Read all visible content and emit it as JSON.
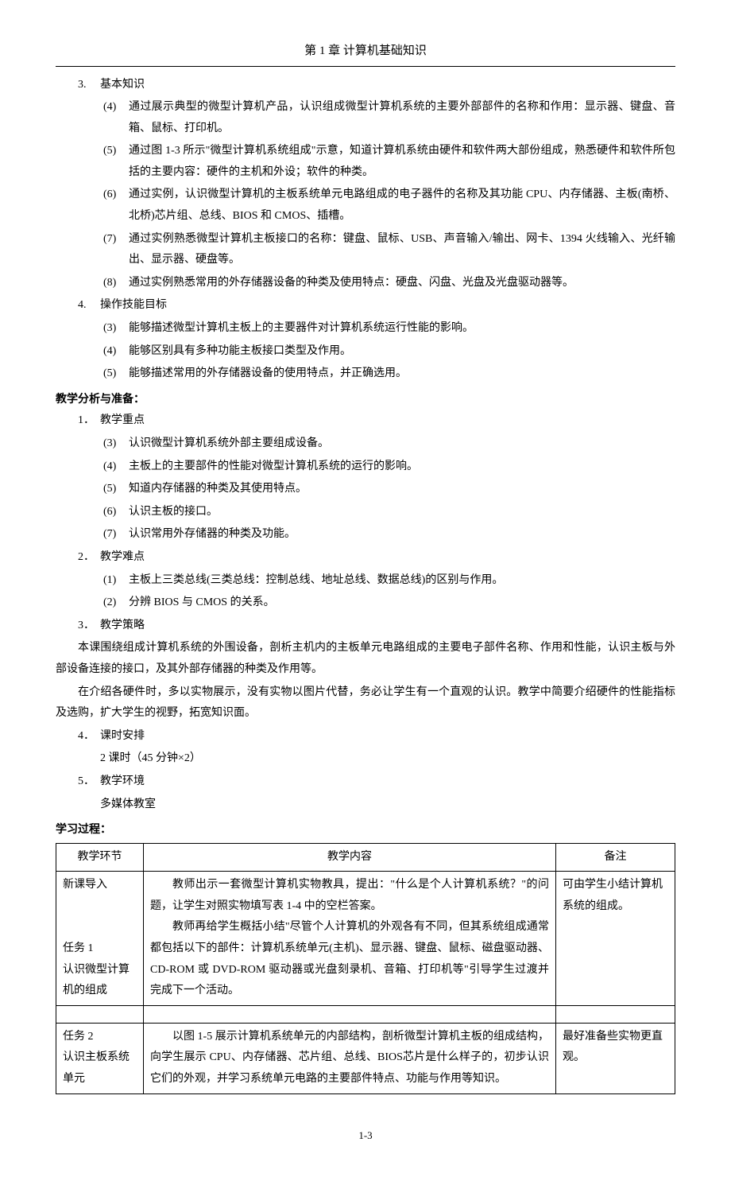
{
  "chapter_title": "第 1 章  计算机基础知识",
  "sections": {
    "s3": {
      "num": "3.",
      "title": "基本知识"
    },
    "s3_items": {
      "i4": {
        "num": "(4)",
        "text": "通过展示典型的微型计算机产品，认识组成微型计算机系统的主要外部部件的名称和作用：显示器、键盘、音箱、鼠标、打印机。"
      },
      "i5": {
        "num": "(5)",
        "text": "通过图 1-3 所示\"微型计算机系统组成\"示意，知道计算机系统由硬件和软件两大部份组成，熟悉硬件和软件所包括的主要内容：硬件的主机和外设；软件的种类。"
      },
      "i6": {
        "num": "(6)",
        "text": "通过实例，认识微型计算机的主板系统单元电路组成的电子器件的名称及其功能 CPU、内存储器、主板(南桥、北桥)芯片组、总线、BIOS 和 CMOS、插槽。"
      },
      "i7": {
        "num": "(7)",
        "text": "通过实例熟悉微型计算机主板接口的名称：键盘、鼠标、USB、声音输入/输出、网卡、1394 火线输入、光纤输出、显示器、硬盘等。"
      },
      "i8": {
        "num": "(8)",
        "text": "通过实例熟悉常用的外存储器设备的种类及使用特点：硬盘、闪盘、光盘及光盘驱动器等。"
      }
    },
    "s4": {
      "num": "4.",
      "title": "操作技能目标"
    },
    "s4_items": {
      "i3": {
        "num": "(3)",
        "text": "能够描述微型计算机主板上的主要器件对计算机系统运行性能的影响。"
      },
      "i4": {
        "num": "(4)",
        "text": "能够区别具有多种功能主板接口类型及作用。"
      },
      "i5": {
        "num": "(5)",
        "text": "能够描述常用的外存储器设备的使用特点，并正确选用。"
      }
    }
  },
  "analysis_heading": "教学分析与准备：",
  "analysis": {
    "a1": {
      "num": "1．",
      "title": "教学重点"
    },
    "a1_items": {
      "i3": {
        "num": "(3)",
        "text": "认识微型计算机系统外部主要组成设备。"
      },
      "i4": {
        "num": "(4)",
        "text": "主板上的主要部件的性能对微型计算机系统的运行的影响。"
      },
      "i5": {
        "num": "(5)",
        "text": "知道内存储器的种类及其使用特点。"
      },
      "i6": {
        "num": "(6)",
        "text": "认识主板的接口。"
      },
      "i7": {
        "num": "(7)",
        "text": "认识常用外存储器的种类及功能。"
      }
    },
    "a2": {
      "num": "2．",
      "title": "教学难点"
    },
    "a2_items": {
      "i1": {
        "num": "(1)",
        "text": "主板上三类总线(三类总线：控制总线、地址总线、数据总线)的区别与作用。"
      },
      "i2": {
        "num": "(2)",
        "text": "分辨 BIOS 与 CMOS 的关系。"
      }
    },
    "a3": {
      "num": "3．",
      "title": "教学策略"
    },
    "a3_para1": "本课围绕组成计算机系统的外围设备，剖析主机内的主板单元电路组成的主要电子部件名称、作用和性能，认识主板与外部设备连接的接口，及其外部存储器的种类及作用等。",
    "a3_para2": "在介绍各硬件时，多以实物展示，没有实物以图片代替，务必让学生有一个直观的认识。教学中简要介绍硬件的性能指标及选购，扩大学生的视野，拓宽知识面。",
    "a4": {
      "num": "4．",
      "title": "课时安排"
    },
    "a4_text": "2 课时（45 分钟×2）",
    "a5": {
      "num": "5．",
      "title": "教学环境"
    },
    "a5_text": "多媒体教室"
  },
  "learn_heading": "学习过程：",
  "table": {
    "headers": {
      "c1": "教学环节",
      "c2": "教学内容",
      "c3": "备注"
    },
    "rows": [
      {
        "c1": "新课导入\n\n\n任务 1\n认识微型计算机的组成",
        "c2": "教师出示一套微型计算机实物教具，提出：\"什么是个人计算机系统？\"的问题，让学生对照实物填写表 1-4 中的空栏答案。\n教师再给学生概括小结\"尽管个人计算机的外观各有不同，但其系统组成通常都包括以下的部件：计算机系统单元(主机)、显示器、键盘、鼠标、磁盘驱动器、CD-ROM 或 DVD-ROM 驱动器或光盘刻录机、音箱、打印机等\"引导学生过渡并完成下一个活动。",
        "c3": "可由学生小结计算机系统的组成。"
      },
      {
        "c1": "任务 2\n认识主板系统单元",
        "c2": "以图 1-5 展示计算机系统单元的内部结构，剖析微型计算机主板的组成结构，向学生展示 CPU、内存储器、芯片组、总线、BIOS芯片是什么样子的，初步认识它们的外观，并学习系统单元电路的主要部件特点、功能与作用等知识。",
        "c3": "最好准备些实物更直观。"
      }
    ]
  },
  "page_number": "1-3"
}
